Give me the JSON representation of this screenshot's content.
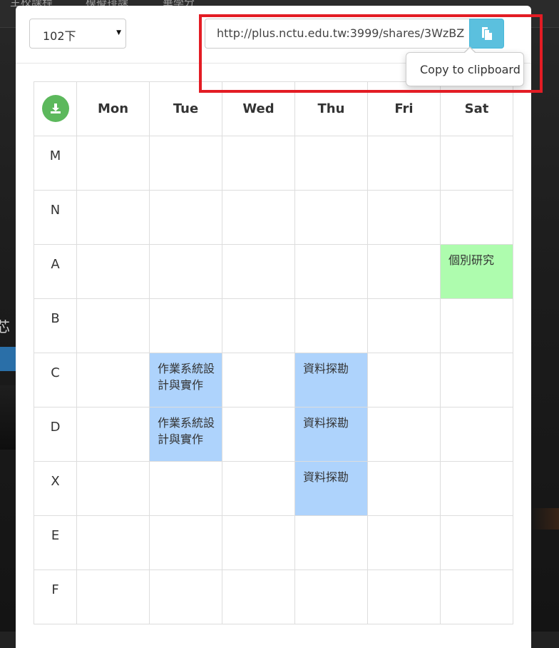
{
  "background": {
    "nav_items": [
      "主校課程",
      "模擬排課",
      "畢學分"
    ],
    "side_char": "芯"
  },
  "header": {
    "semester_select": {
      "value": "102下",
      "options": [
        "102下"
      ]
    },
    "share_url": "http://plus.nctu.edu.tw:3999/shares/3WzBZ",
    "copy_button_icon": "clipboard-icon",
    "tooltip": "Copy to clipboard"
  },
  "timetable": {
    "download_icon": "download-icon",
    "days": [
      "Mon",
      "Tue",
      "Wed",
      "Thu",
      "Fri",
      "Sat"
    ],
    "rows": [
      {
        "period": "M",
        "cells": [
          "",
          "",
          "",
          "",
          "",
          ""
        ]
      },
      {
        "period": "N",
        "cells": [
          "",
          "",
          "",
          "",
          "",
          ""
        ]
      },
      {
        "period": "A",
        "cells": [
          "",
          "",
          "",
          "",
          "",
          "個別研究"
        ]
      },
      {
        "period": "B",
        "cells": [
          "",
          "",
          "",
          "",
          "",
          ""
        ]
      },
      {
        "period": "C",
        "cells": [
          "",
          "作業系統設計與實作",
          "",
          "資料探勘",
          "",
          ""
        ]
      },
      {
        "period": "D",
        "cells": [
          "",
          "作業系統設計與實作",
          "",
          "資料探勘",
          "",
          ""
        ]
      },
      {
        "period": "X",
        "cells": [
          "",
          "",
          "",
          "資料探勘",
          "",
          ""
        ]
      },
      {
        "period": "E",
        "cells": [
          "",
          "",
          "",
          "",
          "",
          ""
        ]
      },
      {
        "period": "F",
        "cells": [
          "",
          "",
          "",
          "",
          "",
          ""
        ]
      }
    ],
    "colors": {
      "major": "#aed3fc",
      "research": "#aefcae"
    }
  },
  "colors": {
    "highlight": "#e31c24",
    "info_button": "#5bc0de",
    "success_button": "#5cb85c"
  }
}
